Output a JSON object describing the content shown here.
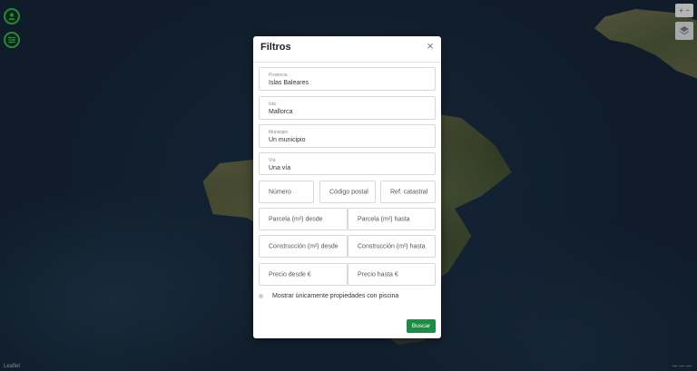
{
  "map": {
    "attribution": "Leaflet",
    "scale": "— — —"
  },
  "controls": {
    "user_icon": "user-icon",
    "filter_icon": "sliders-icon",
    "zoom_label": "+  −",
    "layers_icon": "layers-icon"
  },
  "modal": {
    "title": "Filtros",
    "close_label": "×",
    "fields": {
      "provincia_label": "Provincia",
      "provincia_value": "Islas Baleares",
      "isla_label": "Isla",
      "isla_value": "Mallorca",
      "municipio_label": "Municipio",
      "municipio_value": "Un municipio",
      "via_label": "Vía",
      "via_value": "Una vía",
      "numero_ph": "Número",
      "codigo_postal_ph": "Código postal",
      "ref_catastral_ph": "Ref. catastral",
      "parcela_desde_ph": "Parcela (m²) desde",
      "parcela_hasta_ph": "Parcela (m²) hasta",
      "construccion_desde_ph": "Construcción (m²) desde",
      "construccion_hasta_ph": "Construcción (m²) hasta",
      "precio_desde_ph": "Precio desde €",
      "precio_hasta_ph": "Precio hasta €"
    },
    "checkbox_label": "Mostrar únicamente propiedades con piscina",
    "search_button": "Buscar"
  },
  "colors": {
    "accent": "#1e8b47",
    "fab_border": "#2bb24c"
  }
}
